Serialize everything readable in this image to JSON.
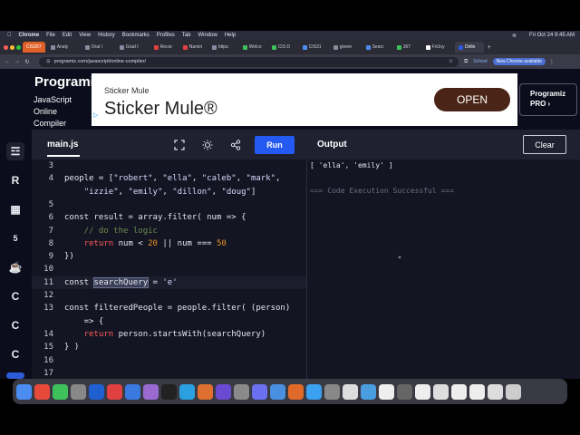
{
  "menubar": {
    "app": "Chrome",
    "items": [
      "File",
      "Edit",
      "View",
      "History",
      "Bookmarks",
      "Profiles",
      "Tab",
      "Window",
      "Help"
    ],
    "datetime": "Fri Oct 24  9:45 AM"
  },
  "browser_tabs": [
    "CIS267",
    "Analy",
    "Oral I",
    "Grad I",
    "Recor",
    "Namin",
    "https:",
    "Welco",
    "CIS D",
    "CIS31",
    "givem",
    "Searc",
    "367",
    "FrtJoy",
    "Onlin"
  ],
  "address": {
    "url": "programiz.com/javascript/online-compiler/",
    "school_label": "School",
    "update_label": "New Chrome available"
  },
  "site": {
    "logo": "Programiz",
    "subtitle_lines": [
      "JavaScript",
      "Online",
      "Compiler"
    ],
    "ad": {
      "brand_small": "Sticker Mule",
      "brand_big": "Sticker Mule®",
      "cta": "OPEN"
    },
    "pro_lines": [
      "Programiz",
      "PRO ›"
    ]
  },
  "editor": {
    "filename": "main.js",
    "run_label": "Run",
    "lines": [
      {
        "n": "3",
        "segs": [
          {
            "t": "",
            "c": "kw"
          }
        ]
      },
      {
        "n": "4",
        "segs": [
          {
            "t": "people = [",
            "c": "kw"
          },
          {
            "t": "\"robert\"",
            "c": "str"
          },
          {
            "t": ", ",
            "c": "kw"
          },
          {
            "t": "\"ella\"",
            "c": "str"
          },
          {
            "t": ", ",
            "c": "kw"
          },
          {
            "t": "\"caleb\"",
            "c": "str"
          },
          {
            "t": ", ",
            "c": "kw"
          },
          {
            "t": "\"mark\"",
            "c": "str"
          },
          {
            "t": ",",
            "c": "kw"
          }
        ]
      },
      {
        "n": "",
        "segs": [
          {
            "t": "    ",
            "c": "kw"
          },
          {
            "t": "\"izzie\"",
            "c": "str"
          },
          {
            "t": ", ",
            "c": "kw"
          },
          {
            "t": "\"emily\"",
            "c": "str"
          },
          {
            "t": ", ",
            "c": "kw"
          },
          {
            "t": "\"dillon\"",
            "c": "str"
          },
          {
            "t": ", ",
            "c": "kw"
          },
          {
            "t": "\"doug\"",
            "c": "str"
          },
          {
            "t": "]",
            "c": "kw"
          }
        ]
      },
      {
        "n": "5",
        "segs": [
          {
            "t": "",
            "c": "kw"
          }
        ]
      },
      {
        "n": "6",
        "segs": [
          {
            "t": "const result = array.filter( ",
            "c": "kw"
          },
          {
            "t": "num",
            "c": "param"
          },
          {
            "t": " => {",
            "c": "kw"
          }
        ]
      },
      {
        "n": "7",
        "segs": [
          {
            "t": "    // do the logic",
            "c": "cm"
          }
        ]
      },
      {
        "n": "8",
        "segs": [
          {
            "t": "    ",
            "c": "kw"
          },
          {
            "t": "return",
            "c": "red"
          },
          {
            "t": " num < ",
            "c": "kw"
          },
          {
            "t": "20",
            "c": "num"
          },
          {
            "t": " || num === ",
            "c": "kw"
          },
          {
            "t": "50",
            "c": "num"
          }
        ]
      },
      {
        "n": "9",
        "segs": [
          {
            "t": "})",
            "c": "kw"
          }
        ]
      },
      {
        "n": "10",
        "segs": [
          {
            "t": "",
            "c": "kw"
          }
        ]
      },
      {
        "n": "11",
        "segs": [
          {
            "t": "const ",
            "c": "kw"
          },
          {
            "t": "searchQuery",
            "c": "sel"
          },
          {
            "t": " = ",
            "c": "kw"
          },
          {
            "t": "'e'",
            "c": "str"
          }
        ],
        "highlight": true
      },
      {
        "n": "12",
        "segs": [
          {
            "t": "",
            "c": "kw"
          }
        ]
      },
      {
        "n": "13",
        "segs": [
          {
            "t": "const filteredPeople = people.filter( (person)",
            "c": "kw"
          }
        ]
      },
      {
        "n": "",
        "segs": [
          {
            "t": "    => {",
            "c": "kw"
          }
        ]
      },
      {
        "n": "14",
        "segs": [
          {
            "t": "    ",
            "c": "kw"
          },
          {
            "t": "return",
            "c": "red"
          },
          {
            "t": " person.startsWith(searchQuery)",
            "c": "kw"
          }
        ]
      },
      {
        "n": "15",
        "segs": [
          {
            "t": "} )",
            "c": "kw"
          }
        ]
      },
      {
        "n": "16",
        "segs": [
          {
            "t": "",
            "c": "kw"
          }
        ]
      },
      {
        "n": "17",
        "segs": [
          {
            "t": "",
            "c": "kw"
          }
        ]
      }
    ]
  },
  "output": {
    "label": "Output",
    "clear_label": "Clear",
    "result": "[ 'ella', 'emily' ]",
    "status": "=== Code Execution Successful ==="
  },
  "languages": [
    "python-icon",
    "r-icon",
    "sql-icon",
    "html-icon",
    "java-icon",
    "c-icon",
    "cpp-icon",
    "csharp-icon",
    "js-icon"
  ],
  "dock_colors": [
    "#4a8cf0",
    "#e84a3a",
    "#3ec15b",
    "#888888",
    "#1f5fd0",
    "#e04040",
    "#3a7ae0",
    "#9a6ad0",
    "#222222",
    "#2aa0e0",
    "#e07030",
    "#6a4ad0",
    "#8a8a8a",
    "#6a70f0",
    "#4a90e0",
    "#e06a2a",
    "#3aa0f0",
    "#888888",
    "#dddddd",
    "#4a9ee0",
    "#eeeeee",
    "#666666",
    "#eeeeee",
    "#dddddd",
    "#eeeeee",
    "#eeeeee",
    "#dddddd",
    "#cccccc"
  ]
}
